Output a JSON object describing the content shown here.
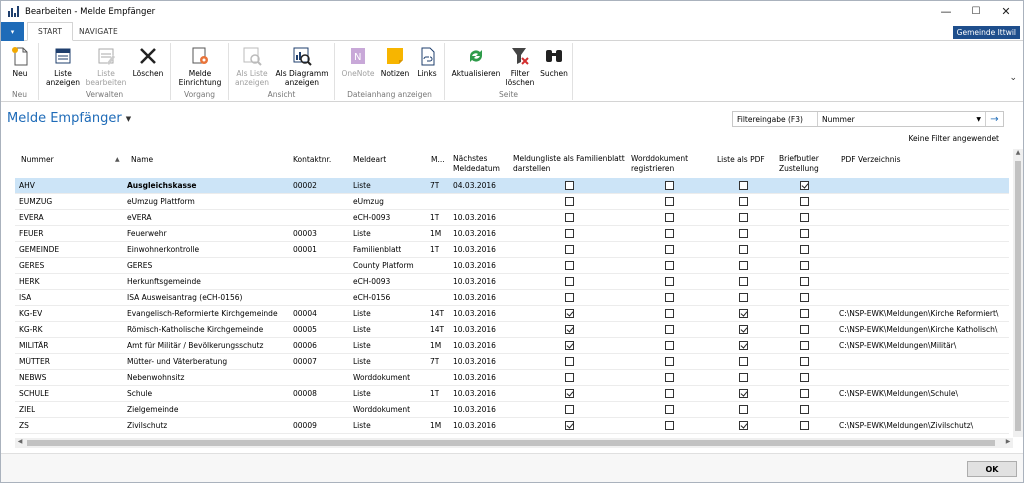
{
  "window": {
    "title": "Bearbeiten - Melde Empfänger",
    "minimize": "—",
    "maximize": "☐",
    "close": "✕"
  },
  "ribbon_tabs": {
    "file": "▾",
    "start": "START",
    "navigate": "NAVIGATE",
    "company": "Gemeinde Ittwil"
  },
  "ribbon": {
    "neu": "Neu",
    "liste_anzeigen": "Liste\nanzeigen",
    "liste_bearbeiten": "Liste\nbearbeiten",
    "loeschen": "Löschen",
    "melde_einrichtung": "Melde\nEinrichtung",
    "als_liste_anzeigen": "Als Liste\nanzeigen",
    "als_diagramm_anzeigen": "Als Diagramm\nanzeigen",
    "onenote": "OneNote",
    "notizen": "Notizen",
    "links": "Links",
    "aktualisieren": "Aktualisieren",
    "filter_loeschen": "Filter\nlöschen",
    "suchen": "Suchen",
    "groups": {
      "neu": "Neu",
      "verwalten": "Verwalten",
      "vorgang": "Vorgang",
      "ansicht": "Ansicht",
      "dateianhang": "Dateianhang anzeigen",
      "seite": "Seite"
    }
  },
  "page": {
    "title": "Melde Empfänger",
    "title_arrow": "▼",
    "collapse_icon": "⌄"
  },
  "filter": {
    "label": "Filtereingabe (F3)",
    "value": "Nummer",
    "dropdown": "▼",
    "go": "→",
    "status": "Keine Filter angewendet"
  },
  "columns": {
    "nummer": "Nummer",
    "sort": "▲",
    "name": "Name",
    "kontakt": "Kontaktnr.",
    "meldeart": "Meldeart",
    "m": "M...",
    "naechstes": "Nächstes\nMeldedatum",
    "meldungliste": "Meldungliste als Familienblatt\ndarstellen",
    "worddokument": "Worddokument\nregistrieren",
    "listepdf": "Liste als PDF",
    "briefbutler": "Briefbutler\nZustellung",
    "pdfverz": "PDF Verzeichnis"
  },
  "rows": [
    {
      "nummer": "AHV",
      "name": "Ausgleichskasse",
      "kontakt": "00002",
      "meldeart": "Liste",
      "m": "7T",
      "datum": "04.03.2016",
      "fam": false,
      "word": false,
      "pdf": false,
      "brief": true,
      "verz": "",
      "selected": true
    },
    {
      "nummer": "EUMZUG",
      "name": "eUmzug Plattform",
      "kontakt": "",
      "meldeart": "eUmzug",
      "m": "",
      "datum": "",
      "fam": false,
      "word": false,
      "pdf": false,
      "brief": false,
      "verz": ""
    },
    {
      "nummer": "EVERA",
      "name": "eVERA",
      "kontakt": "",
      "meldeart": "eCH-0093",
      "m": "1T",
      "datum": "10.03.2016",
      "fam": false,
      "word": false,
      "pdf": false,
      "brief": false,
      "verz": ""
    },
    {
      "nummer": "FEUER",
      "name": "Feuerwehr",
      "kontakt": "00003",
      "meldeart": "Liste",
      "m": "1M",
      "datum": "10.03.2016",
      "fam": false,
      "word": false,
      "pdf": false,
      "brief": false,
      "verz": ""
    },
    {
      "nummer": "GEMEINDE",
      "name": "Einwohnerkontrolle",
      "kontakt": "00001",
      "meldeart": "Familienblatt",
      "m": "1T",
      "datum": "10.03.2016",
      "fam": false,
      "word": false,
      "pdf": false,
      "brief": false,
      "verz": ""
    },
    {
      "nummer": "GERES",
      "name": "GERES",
      "kontakt": "",
      "meldeart": "County Platform",
      "m": "",
      "datum": "10.03.2016",
      "fam": false,
      "word": false,
      "pdf": false,
      "brief": false,
      "verz": ""
    },
    {
      "nummer": "HERK",
      "name": "Herkunftsgemeinde",
      "kontakt": "",
      "meldeart": "eCH-0093",
      "m": "",
      "datum": "10.03.2016",
      "fam": false,
      "word": false,
      "pdf": false,
      "brief": false,
      "verz": ""
    },
    {
      "nummer": "ISA",
      "name": "ISA Ausweisantrag (eCH-0156)",
      "kontakt": "",
      "meldeart": "eCH-0156",
      "m": "",
      "datum": "10.03.2016",
      "fam": false,
      "word": false,
      "pdf": false,
      "brief": false,
      "verz": ""
    },
    {
      "nummer": "KG-EV",
      "name": "Evangelisch-Reformierte Kirchgemeinde",
      "kontakt": "00004",
      "meldeart": "Liste",
      "m": "14T",
      "datum": "10.03.2016",
      "fam": true,
      "word": false,
      "pdf": true,
      "brief": false,
      "verz": "C:\\NSP-EWK\\Meldungen\\Kirche Reformiert\\"
    },
    {
      "nummer": "KG-RK",
      "name": "Römisch-Katholische Kirchgemeinde",
      "kontakt": "00005",
      "meldeart": "Liste",
      "m": "14T",
      "datum": "10.03.2016",
      "fam": true,
      "word": false,
      "pdf": true,
      "brief": false,
      "verz": "C:\\NSP-EWK\\Meldungen\\Kirche Katholisch\\"
    },
    {
      "nummer": "MILITÄR",
      "name": "Amt für Militär / Bevölkerungsschutz",
      "kontakt": "00006",
      "meldeart": "Liste",
      "m": "1M",
      "datum": "10.03.2016",
      "fam": true,
      "word": false,
      "pdf": true,
      "brief": false,
      "verz": "C:\\NSP-EWK\\Meldungen\\Militär\\"
    },
    {
      "nummer": "MÜTTER",
      "name": "Mütter- und Väterberatung",
      "kontakt": "00007",
      "meldeart": "Liste",
      "m": "7T",
      "datum": "10.03.2016",
      "fam": false,
      "word": false,
      "pdf": false,
      "brief": false,
      "verz": ""
    },
    {
      "nummer": "NEBWS",
      "name": "Nebenwohnsitz",
      "kontakt": "",
      "meldeart": "Worddokument",
      "m": "",
      "datum": "10.03.2016",
      "fam": false,
      "word": false,
      "pdf": false,
      "brief": false,
      "verz": ""
    },
    {
      "nummer": "SCHULE",
      "name": "Schule",
      "kontakt": "00008",
      "meldeart": "Liste",
      "m": "1T",
      "datum": "10.03.2016",
      "fam": true,
      "word": false,
      "pdf": true,
      "brief": false,
      "verz": "C:\\NSP-EWK\\Meldungen\\Schule\\"
    },
    {
      "nummer": "ZIEL",
      "name": "Zielgemeinde",
      "kontakt": "",
      "meldeart": "Worddokument",
      "m": "",
      "datum": "10.03.2016",
      "fam": false,
      "word": false,
      "pdf": false,
      "brief": false,
      "verz": ""
    },
    {
      "nummer": "ZS",
      "name": "Zivilschutz",
      "kontakt": "00009",
      "meldeart": "Liste",
      "m": "1M",
      "datum": "10.03.2016",
      "fam": true,
      "word": false,
      "pdf": true,
      "brief": false,
      "verz": "C:\\NSP-EWK\\Meldungen\\Zivilschutz\\"
    }
  ],
  "footer": {
    "ok": "OK"
  },
  "colors": {
    "accent": "#1e6bb8",
    "selected_row": "#cce4f7",
    "company_badge": "#1e4e8c"
  }
}
